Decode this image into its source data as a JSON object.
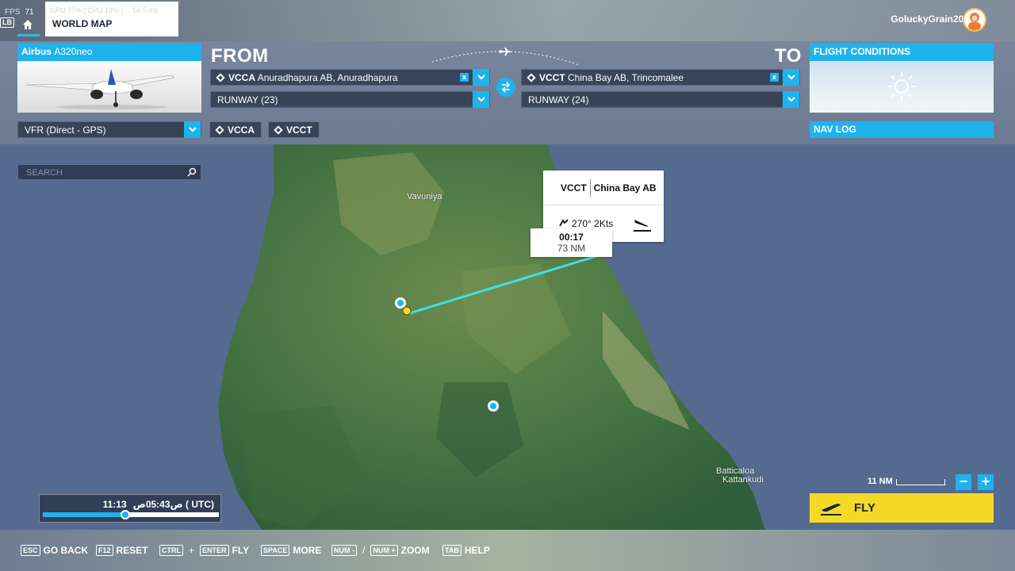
{
  "header": {
    "fps_label": "FPS",
    "fps_value": "71",
    "lb_key": "LB",
    "ghost_stats": "GPU 77%  |  CPU 13%  |  ... 64.5 ms",
    "breadcrumb": "WORLD MAP",
    "username": "GoluckyGrain202"
  },
  "aircraft": {
    "brand": "Airbus",
    "model": "A320neo"
  },
  "route": {
    "from_title": "FROM",
    "to_title": "TO",
    "from_code": "VCCA",
    "from_name": "Anuradhapura AB, Anuradhapura",
    "from_runway": "RUNWAY (23)",
    "to_code": "VCCT",
    "to_name": "China Bay AB, Trincomalee",
    "to_runway": "RUNWAY (24)",
    "clear_glyph": "x"
  },
  "conditions": {
    "title": "FLIGHT CONDITIONS",
    "weather_icon": "sun-icon"
  },
  "flightplan": {
    "mode": "VFR (Direct - GPS)",
    "waypoint_1": "VCCA",
    "waypoint_2": "VCCT",
    "navlog": "NAV LOG"
  },
  "search": {
    "placeholder": "SEARCH"
  },
  "map": {
    "towns": [
      "Vavuniya",
      "Batticaloa",
      "Kattankudi"
    ],
    "info_code": "VCCT",
    "info_name": "China Bay AB",
    "wind": "270° 2Kts",
    "leg_time": "00:17",
    "leg_distance": "73 NM"
  },
  "time": {
    "local": "11:13",
    "utc": "ص05:43ص ( UTC)",
    "progress": 0.47
  },
  "zoom": {
    "scale": "11 NM",
    "minus": "−",
    "plus": "+"
  },
  "fly": {
    "label": "FLY"
  },
  "shortcuts": [
    {
      "keys": [
        "ESC"
      ],
      "label": "GO BACK"
    },
    {
      "keys": [
        "F12"
      ],
      "label": "RESET"
    },
    {
      "keys": [
        "CTRL",
        "ENTER"
      ],
      "label": "FLY"
    },
    {
      "keys": [
        "SPACE"
      ],
      "label": "MORE"
    },
    {
      "keys": [
        "NUM -",
        "NUM +"
      ],
      "label": "ZOOM"
    },
    {
      "keys": [
        "TAB"
      ],
      "label": "HELP"
    }
  ],
  "colors": {
    "accent": "#1fb3ec",
    "fly": "#f4da26",
    "route_line": "#3fe0e8",
    "sea": "#556a8f",
    "land": "#4f7b44"
  }
}
